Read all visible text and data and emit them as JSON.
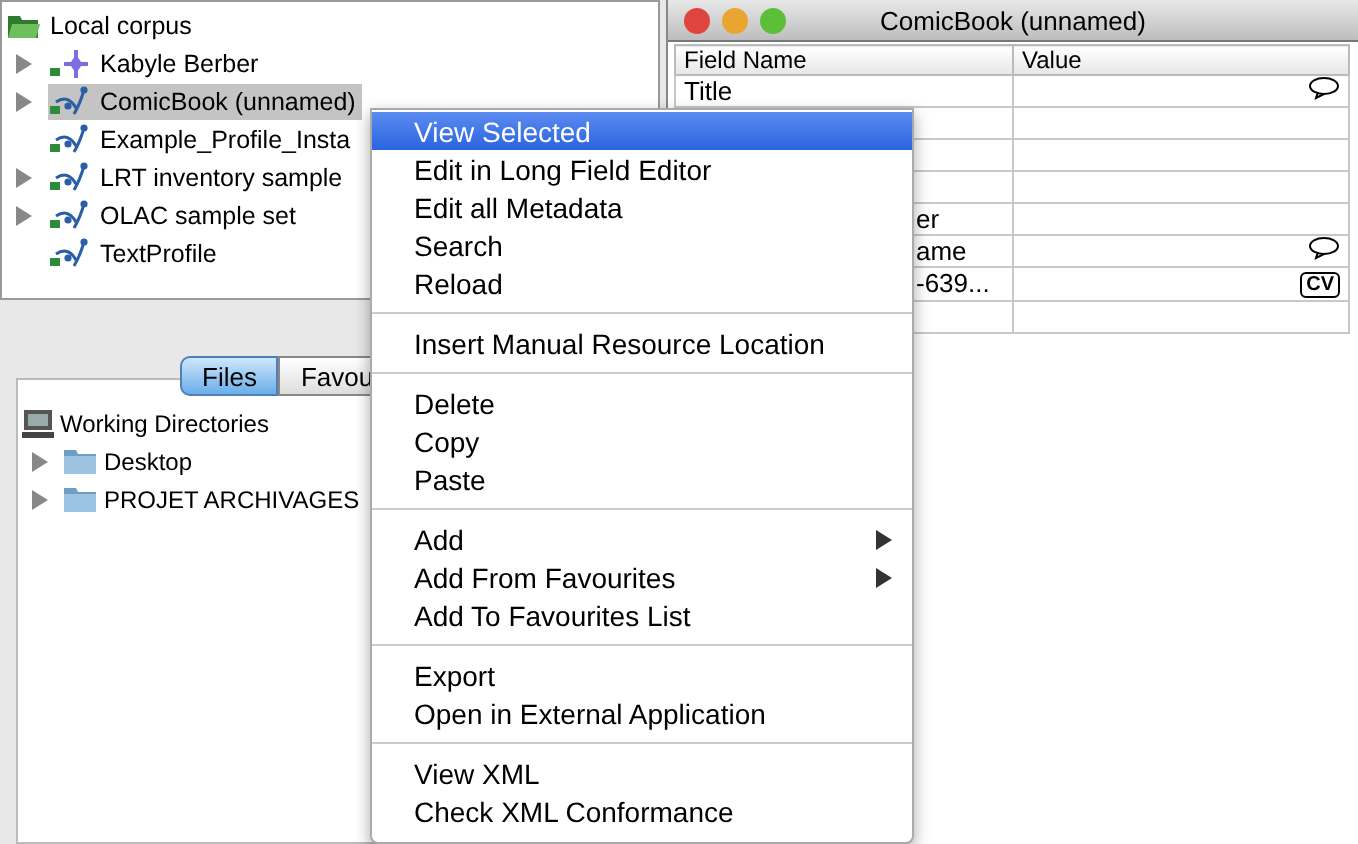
{
  "corpus_tree": {
    "label": "Local corpus",
    "children": [
      {
        "label": "Kabyle Berber",
        "kind": "corpus",
        "expandable": true,
        "selected": false
      },
      {
        "label": "ComicBook (unnamed)",
        "kind": "profile",
        "expandable": true,
        "selected": true
      },
      {
        "label": "Example_Profile_Insta",
        "kind": "profile",
        "expandable": false,
        "selected": false
      },
      {
        "label": "LRT inventory sample",
        "kind": "profile",
        "expandable": true,
        "selected": false
      },
      {
        "label": "OLAC sample set",
        "kind": "profile",
        "expandable": true,
        "selected": false
      },
      {
        "label": "TextProfile",
        "kind": "profile",
        "expandable": false,
        "selected": false
      }
    ]
  },
  "file_tabs": [
    {
      "label": "Files",
      "selected": true
    },
    {
      "label": "Favou",
      "selected": false
    }
  ],
  "file_tree": {
    "label": "Working Directories",
    "children": [
      {
        "label": "Desktop",
        "expandable": true
      },
      {
        "label": "PROJET ARCHIVAGES",
        "expandable": true
      }
    ]
  },
  "metadata_window": {
    "title": "ComicBook (unnamed)",
    "columns": [
      "Field Name",
      "Value"
    ],
    "rows": [
      {
        "field": "Title",
        "kind": "comment"
      },
      {
        "kind": "plain"
      },
      {
        "kind": "plain"
      },
      {
        "kind": "plain"
      },
      {
        "field": "er",
        "kind": "plain"
      },
      {
        "field": "ame",
        "kind": "comment"
      },
      {
        "field": "-639...",
        "kind": "cv",
        "badge": "CV"
      },
      {
        "kind": "plain"
      }
    ]
  },
  "context_menu": [
    [
      {
        "label": "View Selected",
        "selected": true,
        "submenu": false
      },
      {
        "label": "Edit in Long Field Editor",
        "selected": false,
        "submenu": false
      },
      {
        "label": "Edit all Metadata",
        "selected": false,
        "submenu": false
      },
      {
        "label": "Search",
        "selected": false,
        "submenu": false
      },
      {
        "label": "Reload",
        "selected": false,
        "submenu": false
      }
    ],
    [
      {
        "label": "Insert Manual Resource Location",
        "selected": false,
        "submenu": false
      }
    ],
    [
      {
        "label": "Delete",
        "selected": false,
        "submenu": false
      },
      {
        "label": "Copy",
        "selected": false,
        "submenu": false
      },
      {
        "label": "Paste",
        "selected": false,
        "submenu": false
      }
    ],
    [
      {
        "label": "Add",
        "selected": false,
        "submenu": true
      },
      {
        "label": "Add From Favourites",
        "selected": false,
        "submenu": true
      },
      {
        "label": "Add To Favourites List",
        "selected": false,
        "submenu": false
      }
    ],
    [
      {
        "label": "Export",
        "selected": false,
        "submenu": false
      },
      {
        "label": "Open in External Application",
        "selected": false,
        "submenu": false
      }
    ],
    [
      {
        "label": "View XML",
        "selected": false,
        "submenu": false
      },
      {
        "label": "Check XML Conformance",
        "selected": false,
        "submenu": false
      }
    ]
  ]
}
